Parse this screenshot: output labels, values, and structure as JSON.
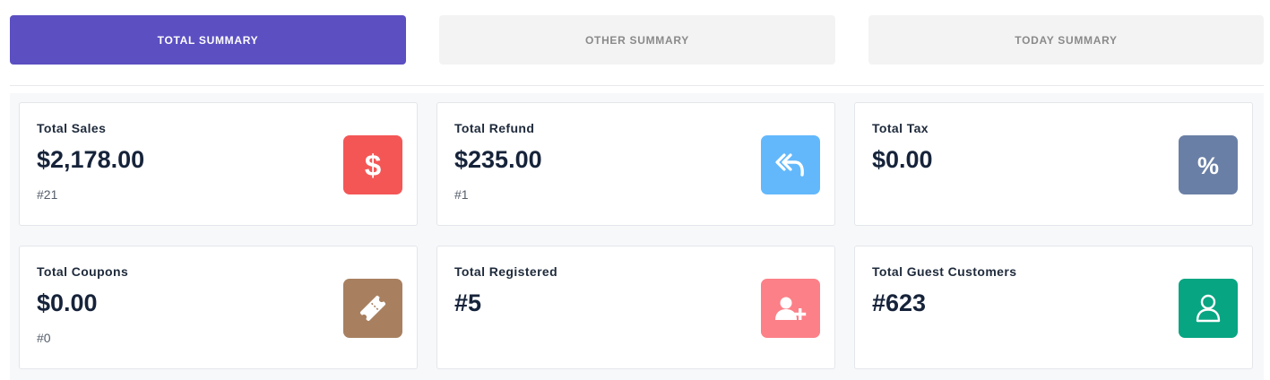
{
  "tabs": [
    {
      "label": "TOTAL SUMMARY",
      "active": true
    },
    {
      "label": "OTHER SUMMARY",
      "active": false
    },
    {
      "label": "TODAY SUMMARY",
      "active": false
    }
  ],
  "cards": [
    {
      "title": "Total Sales",
      "value": "$2,178.00",
      "sub": "#21",
      "icon": "dollar-icon",
      "color": "#f45656"
    },
    {
      "title": "Total Refund",
      "value": "$235.00",
      "sub": "#1",
      "icon": "reply-all-icon",
      "color": "#63b8fc"
    },
    {
      "title": "Total Tax",
      "value": "$0.00",
      "sub": "",
      "icon": "percent-icon",
      "color": "#6a7fa6"
    },
    {
      "title": "Total Coupons",
      "value": "$0.00",
      "sub": "#0",
      "icon": "ticket-icon",
      "color": "#a88060"
    },
    {
      "title": "Total Registered",
      "value": "#5",
      "sub": "",
      "icon": "user-plus-icon",
      "color": "#fc8088"
    },
    {
      "title": "Total Guest Customers",
      "value": "#623",
      "sub": "",
      "icon": "user-icon",
      "color": "#08a582"
    }
  ],
  "colors": {
    "accent": "#5b4fc2",
    "tab_inactive_bg": "#f3f3f3",
    "tab_inactive_text": "#8a8a8a"
  }
}
